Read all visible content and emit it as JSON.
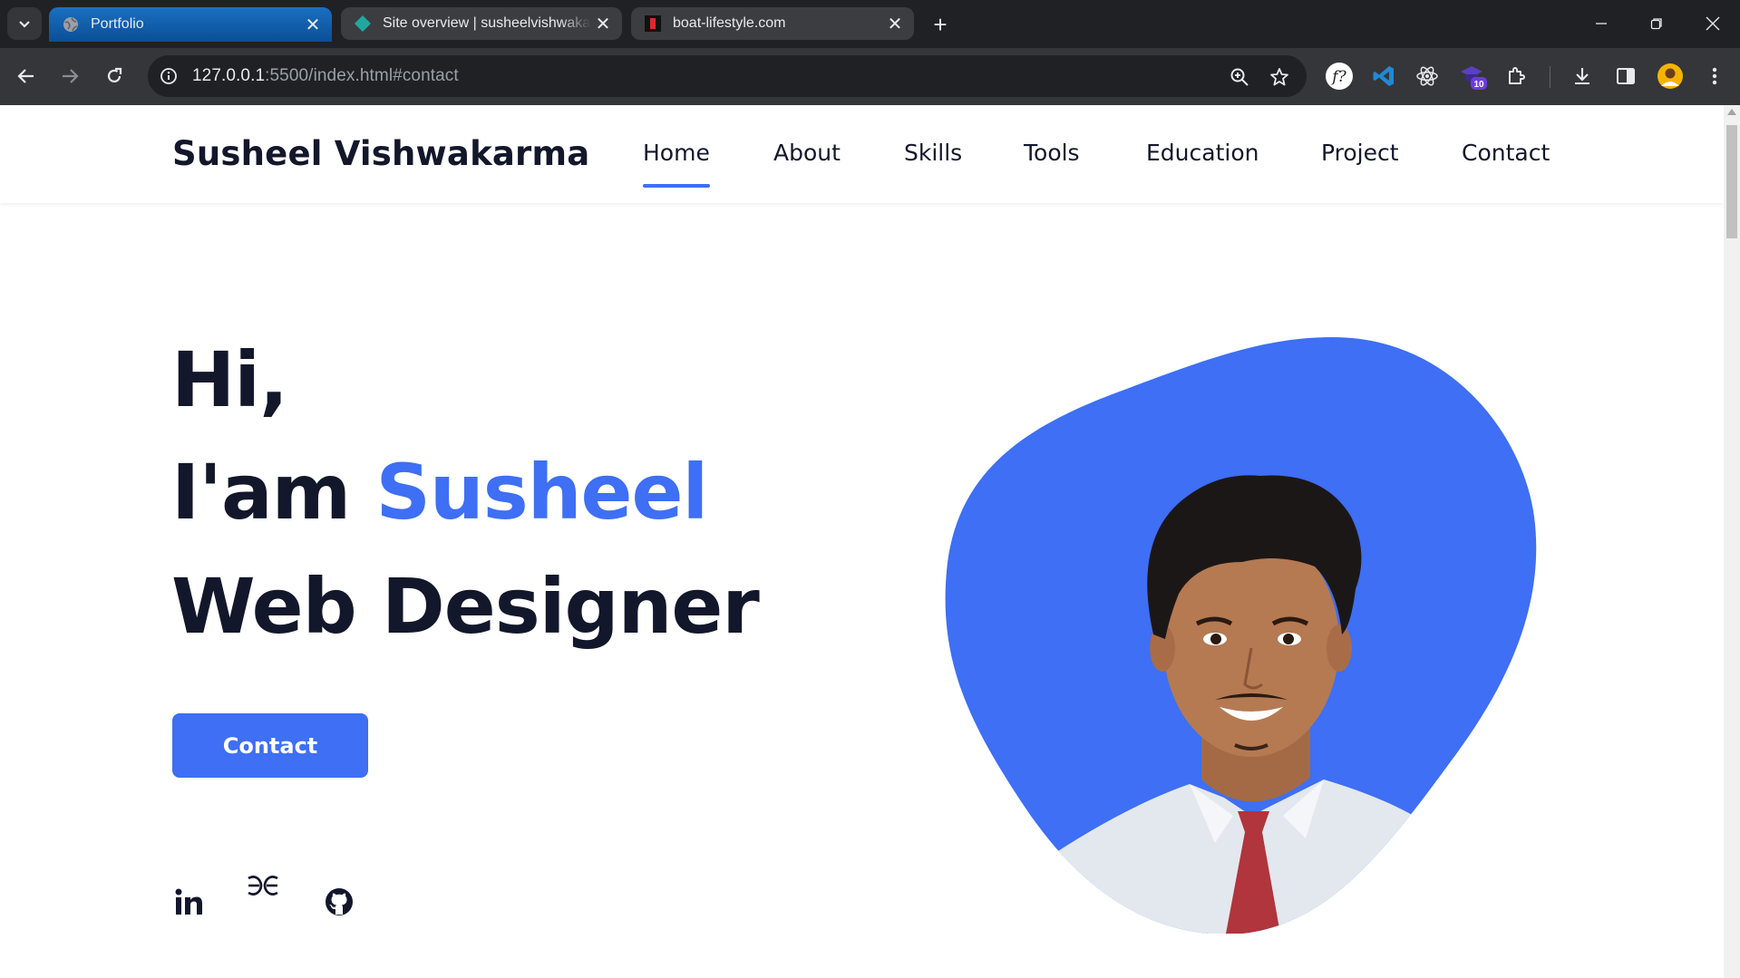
{
  "browser": {
    "tabs": [
      {
        "title": "Portfolio",
        "favicon": "globe-icon",
        "active": true
      },
      {
        "title": "Site overview | susheelvishwakarma",
        "favicon": "netlify-diamond-icon",
        "active": false
      },
      {
        "title": "boat-lifestyle.com",
        "favicon": "boat-logo-icon",
        "active": false
      }
    ],
    "url_host": "127.0.0.1",
    "url_rest": ":5500/index.html#contact",
    "extension_badge": "10"
  },
  "site": {
    "brand": "Susheel Vishwakarma",
    "nav": [
      "Home",
      "About",
      "Skills",
      "Tools",
      "Education",
      "Project",
      "Contact"
    ],
    "active_nav": "Home",
    "hero": {
      "line1": "Hi,",
      "line2_prefix": "I'am ",
      "line2_name": "Susheel",
      "line3": "Web Designer"
    },
    "contact_button": "Contact",
    "social": [
      "linkedin-icon",
      "geeksforgeeks-icon",
      "github-icon"
    ]
  },
  "colors": {
    "accent": "#3e6ff4",
    "text_dark": "#13172b",
    "chrome_bg": "#202124",
    "toolbar_bg": "#35363a",
    "active_tab": "#0b5cad"
  }
}
